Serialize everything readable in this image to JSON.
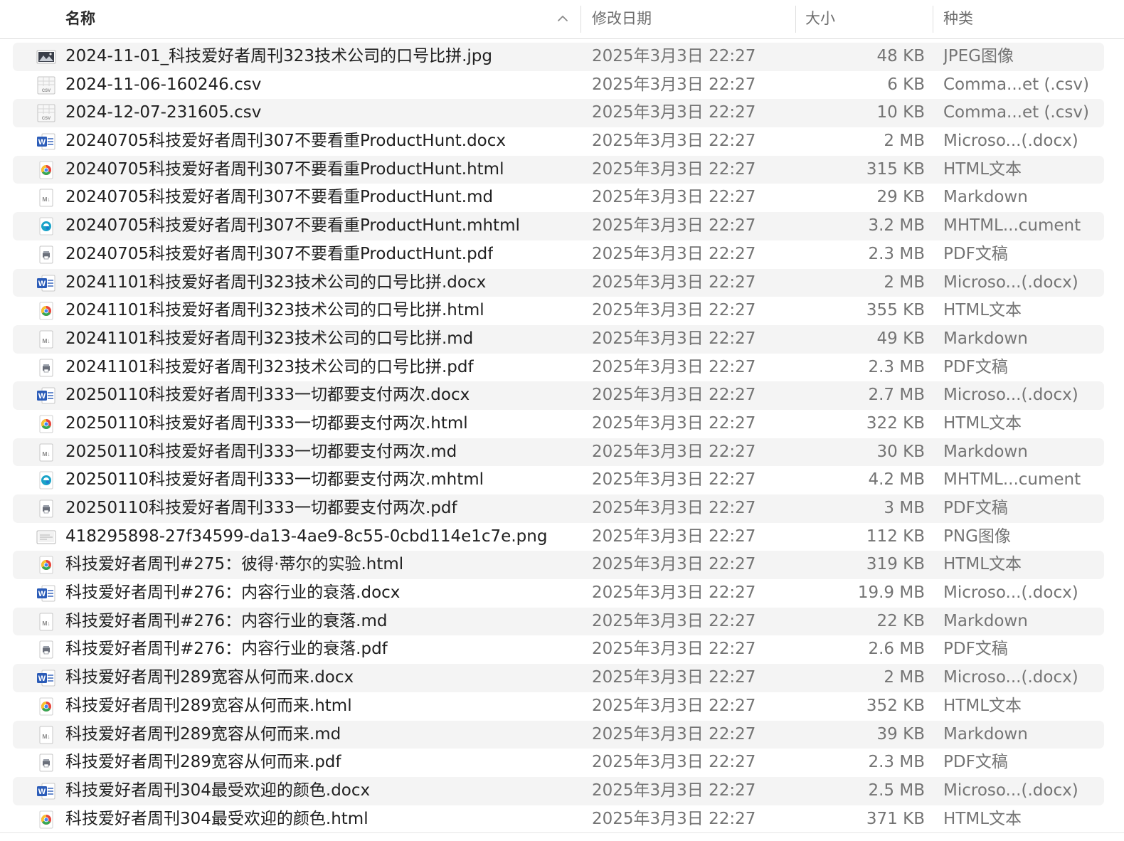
{
  "columns": {
    "name": "名称",
    "date": "修改日期",
    "size": "大小",
    "kind": "种类"
  },
  "sort": {
    "column": "name",
    "direction": "ascending",
    "icon": "chevron-up-icon"
  },
  "colors": {
    "row_alt": "#f4f4f4",
    "word_blue": "#2b5cb8",
    "chrome_red": "#e8443a",
    "chrome_yellow": "#f7c32f",
    "chrome_green": "#35a853",
    "chrome_blue": "#4286f5",
    "edge_teal": "#1aa3c8"
  },
  "files": [
    {
      "icon": "jpg",
      "name": "2024-11-01_科技爱好者周刊323技术公司的口号比拼.jpg",
      "date": "2025年3月3日 22:27",
      "size": "48 KB",
      "kind": "JPEG图像"
    },
    {
      "icon": "csv",
      "name": "2024-11-06-160246.csv",
      "date": "2025年3月3日 22:27",
      "size": "6 KB",
      "kind": "Comma...et (.csv)"
    },
    {
      "icon": "csv",
      "name": "2024-12-07-231605.csv",
      "date": "2025年3月3日 22:27",
      "size": "10 KB",
      "kind": "Comma...et (.csv)"
    },
    {
      "icon": "docx",
      "name": "20240705科技爱好者周刊307不要看重ProductHunt.docx",
      "date": "2025年3月3日 22:27",
      "size": "2 MB",
      "kind": "Microso...(.docx)"
    },
    {
      "icon": "html",
      "name": "20240705科技爱好者周刊307不要看重ProductHunt.html",
      "date": "2025年3月3日 22:27",
      "size": "315 KB",
      "kind": "HTML文本"
    },
    {
      "icon": "md",
      "name": "20240705科技爱好者周刊307不要看重ProductHunt.md",
      "date": "2025年3月3日 22:27",
      "size": "29 KB",
      "kind": "Markdown"
    },
    {
      "icon": "mhtml",
      "name": "20240705科技爱好者周刊307不要看重ProductHunt.mhtml",
      "date": "2025年3月3日 22:27",
      "size": "3.2 MB",
      "kind": "MHTML...cument"
    },
    {
      "icon": "pdf",
      "name": "20240705科技爱好者周刊307不要看重ProductHunt.pdf",
      "date": "2025年3月3日 22:27",
      "size": "2.3 MB",
      "kind": "PDF文稿"
    },
    {
      "icon": "docx",
      "name": "20241101科技爱好者周刊323技术公司的口号比拼.docx",
      "date": "2025年3月3日 22:27",
      "size": "2 MB",
      "kind": "Microso...(.docx)"
    },
    {
      "icon": "html",
      "name": "20241101科技爱好者周刊323技术公司的口号比拼.html",
      "date": "2025年3月3日 22:27",
      "size": "355 KB",
      "kind": "HTML文本"
    },
    {
      "icon": "md",
      "name": "20241101科技爱好者周刊323技术公司的口号比拼.md",
      "date": "2025年3月3日 22:27",
      "size": "49 KB",
      "kind": "Markdown"
    },
    {
      "icon": "pdf",
      "name": "20241101科技爱好者周刊323技术公司的口号比拼.pdf",
      "date": "2025年3月3日 22:27",
      "size": "2.3 MB",
      "kind": "PDF文稿"
    },
    {
      "icon": "docx",
      "name": "20250110科技爱好者周刊333一切都要支付两次.docx",
      "date": "2025年3月3日 22:27",
      "size": "2.7 MB",
      "kind": "Microso...(.docx)"
    },
    {
      "icon": "html",
      "name": "20250110科技爱好者周刊333一切都要支付两次.html",
      "date": "2025年3月3日 22:27",
      "size": "322 KB",
      "kind": "HTML文本"
    },
    {
      "icon": "md",
      "name": "20250110科技爱好者周刊333一切都要支付两次.md",
      "date": "2025年3月3日 22:27",
      "size": "30 KB",
      "kind": "Markdown"
    },
    {
      "icon": "mhtml",
      "name": "20250110科技爱好者周刊333一切都要支付两次.mhtml",
      "date": "2025年3月3日 22:27",
      "size": "4.2 MB",
      "kind": "MHTML...cument"
    },
    {
      "icon": "pdf",
      "name": "20250110科技爱好者周刊333一切都要支付两次.pdf",
      "date": "2025年3月3日 22:27",
      "size": "3 MB",
      "kind": "PDF文稿"
    },
    {
      "icon": "png",
      "name": "418295898-27f34599-da13-4ae9-8c55-0cbd114e1c7e.png",
      "date": "2025年3月3日 22:27",
      "size": "112 KB",
      "kind": "PNG图像"
    },
    {
      "icon": "html",
      "name": "科技爱好者周刊#275：彼得·蒂尔的实验.html",
      "date": "2025年3月3日 22:27",
      "size": "319 KB",
      "kind": "HTML文本"
    },
    {
      "icon": "docx",
      "name": "科技爱好者周刊#276：内容行业的衰落.docx",
      "date": "2025年3月3日 22:27",
      "size": "19.9 MB",
      "kind": "Microso...(.docx)"
    },
    {
      "icon": "md",
      "name": "科技爱好者周刊#276：内容行业的衰落.md",
      "date": "2025年3月3日 22:27",
      "size": "22 KB",
      "kind": "Markdown"
    },
    {
      "icon": "pdf",
      "name": "科技爱好者周刊#276：内容行业的衰落.pdf",
      "date": "2025年3月3日 22:27",
      "size": "2.6 MB",
      "kind": "PDF文稿"
    },
    {
      "icon": "docx",
      "name": "科技爱好者周刊289宽容从何而来.docx",
      "date": "2025年3月3日 22:27",
      "size": "2 MB",
      "kind": "Microso...(.docx)"
    },
    {
      "icon": "html",
      "name": "科技爱好者周刊289宽容从何而来.html",
      "date": "2025年3月3日 22:27",
      "size": "352 KB",
      "kind": "HTML文本"
    },
    {
      "icon": "md",
      "name": "科技爱好者周刊289宽容从何而来.md",
      "date": "2025年3月3日 22:27",
      "size": "39 KB",
      "kind": "Markdown"
    },
    {
      "icon": "pdf",
      "name": "科技爱好者周刊289宽容从何而来.pdf",
      "date": "2025年3月3日 22:27",
      "size": "2.3 MB",
      "kind": "PDF文稿"
    },
    {
      "icon": "docx",
      "name": "科技爱好者周刊304最受欢迎的颜色.docx",
      "date": "2025年3月3日 22:27",
      "size": "2.5 MB",
      "kind": "Microso...(.docx)"
    },
    {
      "icon": "html",
      "name": "科技爱好者周刊304最受欢迎的颜色.html",
      "date": "2025年3月3日 22:27",
      "size": "371 KB",
      "kind": "HTML文本"
    }
  ]
}
